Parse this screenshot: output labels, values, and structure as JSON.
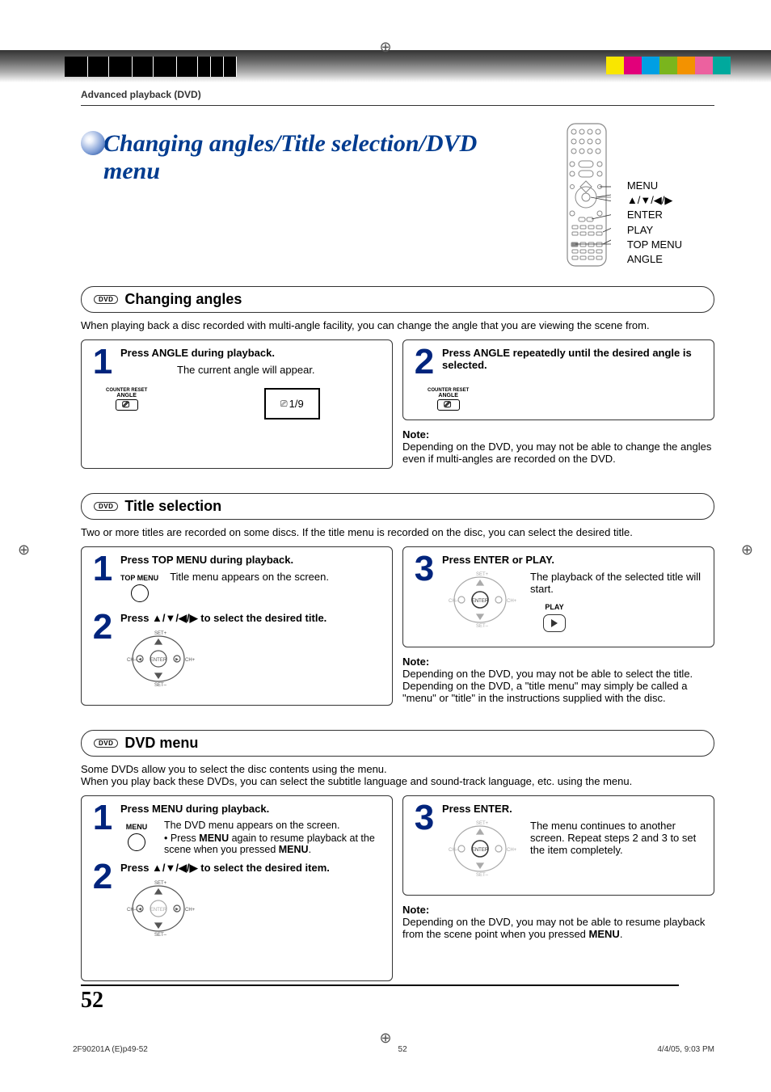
{
  "header": {
    "breadcrumb": "Advanced playback (DVD)",
    "page_title": "Changing angles/Title selection/DVD menu"
  },
  "remote": {
    "labels": [
      "MENU",
      "▲/▼/◀/▶",
      "ENTER",
      "PLAY",
      "TOP MENU",
      "ANGLE"
    ]
  },
  "sections": {
    "changing_angles": {
      "badge": "DVD",
      "title": "Changing angles",
      "intro": "When playing back a disc recorded with multi-angle facility, you can change the angle that you are viewing the scene from.",
      "step1_title": "Press ANGLE during playback.",
      "step1_sub": "The current angle will appear.",
      "angle_counter_reset": "COUNTER RESET",
      "angle_label": "ANGLE",
      "angle_icon": "⎚",
      "osd_value": "1/9",
      "step2_title": "Press ANGLE repeatedly until the desired angle is selected.",
      "note_label": "Note:",
      "note_body": "Depending on the DVD, you may not be able to change the angles even if multi-angles are recorded on the DVD."
    },
    "title_selection": {
      "badge": "DVD",
      "title": "Title selection",
      "intro": "Two or more titles are recorded on some discs. If the title menu is recorded on the disc, you can select the desired title.",
      "step1_title": "Press TOP MENU during playback.",
      "step1_sub": "Title menu appears on the screen.",
      "topmenu_label": "TOP MENU",
      "step2_title_pre": "Press ",
      "step2_arrows": "▲/▼/◀/▶",
      "step2_title_post": " to select the desired title.",
      "step3_title": "Press ENTER or PLAY.",
      "step3_sub": "The playback of the selected title will start.",
      "play_label": "PLAY",
      "note_label": "Note:",
      "note_line1": "Depending on the DVD, you may not be able to select the title.",
      "note_line2": "Depending on the DVD, a \"title menu\" may simply be called a \"menu\" or \"title\" in the instructions supplied with the disc."
    },
    "dvd_menu": {
      "badge": "DVD",
      "title": "DVD menu",
      "intro_line1": "Some DVDs allow you to select the disc contents using the menu.",
      "intro_line2": "When you play back these DVDs, you can select the subtitle language and sound-track language, etc. using the menu.",
      "step1_title": "Press MENU during playback.",
      "step1_sub1": "The DVD menu appears on the screen.",
      "step1_sub2_pre": "Press ",
      "step1_sub2_bold": "MENU",
      "step1_sub2_mid": " again to resume playback at the scene when you pressed ",
      "step1_sub2_bold2": "MENU",
      "step1_sub2_end": ".",
      "menu_label": "MENU",
      "step2_title_pre": "Press ",
      "step2_arrows": "▲/▼/◀/▶",
      "step2_title_post": " to select the desired item.",
      "step3_title": "Press ENTER.",
      "step3_sub": "The menu continues to another screen. Repeat steps 2 and 3 to set the item completely.",
      "note_label": "Note:",
      "note_body_pre": "Depending on the DVD, you may not be able to resume playback from the scene point when you pressed ",
      "note_body_bold": "MENU",
      "note_body_end": "."
    }
  },
  "footer": {
    "page_number": "52",
    "doc_ref": "2F90201A (E)p49-52",
    "page_ref": "52",
    "timestamp": "4/4/05, 9:03 PM"
  },
  "print_colors": [
    "#f9e600",
    "#e2007a",
    "#009fe3",
    "#7ab51d",
    "#f39200",
    "#ec619f",
    "#00a99d"
  ]
}
